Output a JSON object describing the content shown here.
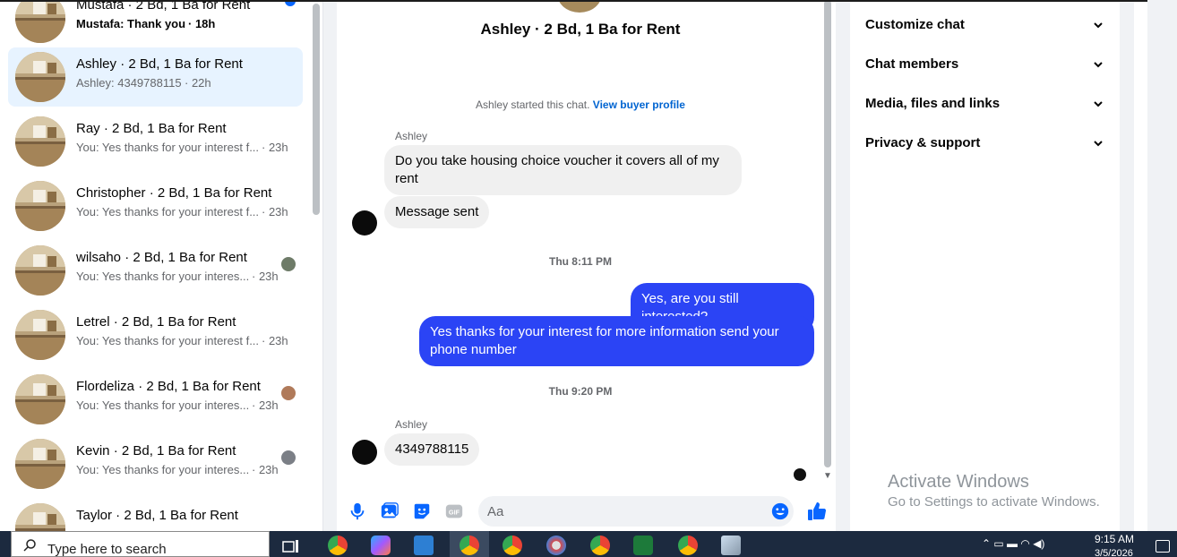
{
  "conversations": [
    {
      "title": "Mustafa · 2 Bd, 1 Ba for Rent",
      "preview": "Mustafa: Thank you",
      "time": "· 18h",
      "unread": true
    },
    {
      "title": "Ashley · 2 Bd, 1 Ba for Rent",
      "preview": "Ashley: 4349788115",
      "time": "· 22h",
      "active": true
    },
    {
      "title": "Ray · 2 Bd, 1 Ba for Rent",
      "preview": "You: Yes thanks for your interest f...",
      "time": "· 23h"
    },
    {
      "title": "Christopher · 2 Bd, 1 Ba for Rent",
      "preview": "You: Yes thanks for your interest f...",
      "time": "· 23h"
    },
    {
      "title": "wilsaho · 2 Bd, 1 Ba for Rent",
      "preview": "You: Yes thanks for your interes...",
      "time": "· 23h"
    },
    {
      "title": "Letrel · 2 Bd, 1 Ba for Rent",
      "preview": "You: Yes thanks for your interest f...",
      "time": "· 23h"
    },
    {
      "title": "Flordeliza · 2 Bd, 1 Ba for Rent",
      "preview": "You: Yes thanks for your interes...",
      "time": "· 23h"
    },
    {
      "title": "Kevin · 2 Bd, 1 Ba for Rent",
      "preview": "You: Yes thanks for your interes...",
      "time": "· 23h"
    },
    {
      "title": "Taylor · 2 Bd, 1 Ba for Rent",
      "preview": "",
      "time": ""
    }
  ],
  "chat": {
    "title": "Ashley · 2 Bd, 1 Ba for Rent",
    "started_text": "Ashley started this chat.",
    "view_profile_link": "View buyer profile",
    "sender_1": "Ashley",
    "msg_1": "Do you take housing choice voucher it covers all of my rent",
    "msg_2": "Message sent",
    "timestamp_1": "Thu 8:11 PM",
    "msg_3": "Yes, are you still interested?",
    "msg_4": "Yes thanks for your interest for more information send your phone number",
    "timestamp_2": "Thu 9:20 PM",
    "sender_2": "Ashley",
    "msg_5": "4349788115",
    "input_placeholder": "Aa"
  },
  "info_panel": {
    "items": [
      "Customize chat",
      "Chat members",
      "Media, files and links",
      "Privacy & support"
    ]
  },
  "watermark": {
    "title": "Activate Windows",
    "subtitle": "Go to Settings to activate Windows."
  },
  "taskbar": {
    "search_placeholder": "Type here to search",
    "time": "9:15 AM",
    "date": "3/5/2026"
  },
  "colors": {
    "outgoing_bubble": "#2b44f5",
    "incoming_bubble": "#f0f0f0",
    "accent": "#0866ff",
    "active_conversation": "#e7f3ff",
    "taskbar": "#1c2a3f"
  }
}
